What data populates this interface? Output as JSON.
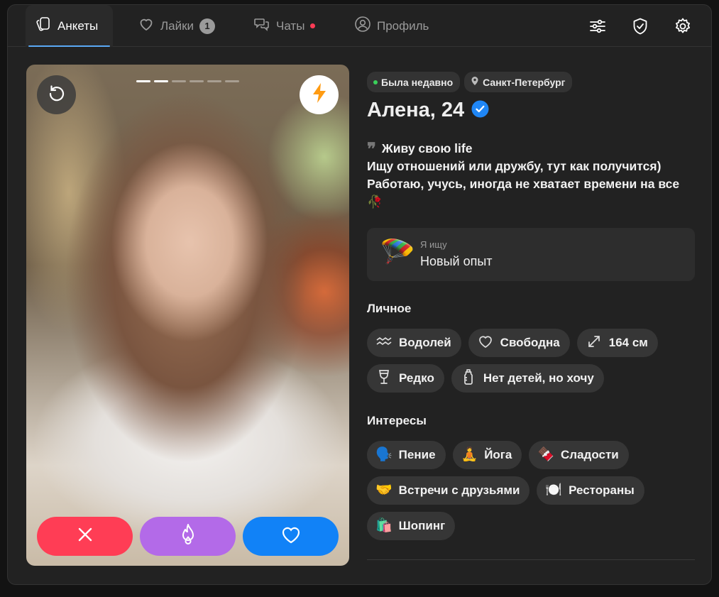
{
  "nav": {
    "tabs": [
      {
        "label": "Анкеты",
        "icon": "cards-icon"
      },
      {
        "label": "Лайки",
        "icon": "heart-icon",
        "badge": "1"
      },
      {
        "label": "Чаты",
        "icon": "chat-bubbles-icon"
      },
      {
        "label": "Профиль",
        "icon": "user-circle-icon"
      }
    ],
    "right_icons": [
      "filters-icon",
      "shield-check-icon",
      "gear-icon"
    ],
    "accent": "#5aa9f5"
  },
  "photo": {
    "count": 6,
    "current": 2
  },
  "actions": {
    "dislike_color": "#ff3d55",
    "superlike_color": "#b36ae8",
    "like_color": "#1182f7"
  },
  "profile": {
    "status": "Была недавно",
    "city": "Санкт-Петербург",
    "name": "Алена, 24",
    "verified": true,
    "bio": {
      "line1": "Живу свою life",
      "line2": "Ищу отношений или дружбу, тут как получится)",
      "line3": "Работаю, учусь, иногда не хватает времени на все",
      "line4": "🥀"
    },
    "seeking": {
      "icon": "🪂",
      "label": "Я ищу",
      "value": "Новый опыт"
    },
    "personal_title": "Личное",
    "personal": [
      {
        "label": "Водолей",
        "icon": "aquarius-icon"
      },
      {
        "label": "Свободна",
        "icon": "heart-outline-icon"
      },
      {
        "label": "164 см",
        "icon": "expand-arrows-icon"
      },
      {
        "label": "Редко",
        "icon": "wine-glass-icon"
      },
      {
        "label": "Нет детей, но хочу",
        "icon": "baby-bottle-icon"
      }
    ],
    "interests_title": "Интересы",
    "interests": [
      {
        "label": "Пение",
        "emoji": "🗣️"
      },
      {
        "label": "Йога",
        "emoji": "🧘"
      },
      {
        "label": "Сладости",
        "emoji": "🍫"
      },
      {
        "label": "Встречи с друзьями",
        "emoji": "🤝"
      },
      {
        "label": "Рестораны",
        "emoji": "🍽️"
      },
      {
        "label": "Шопинг",
        "emoji": "🛍️"
      }
    ]
  }
}
